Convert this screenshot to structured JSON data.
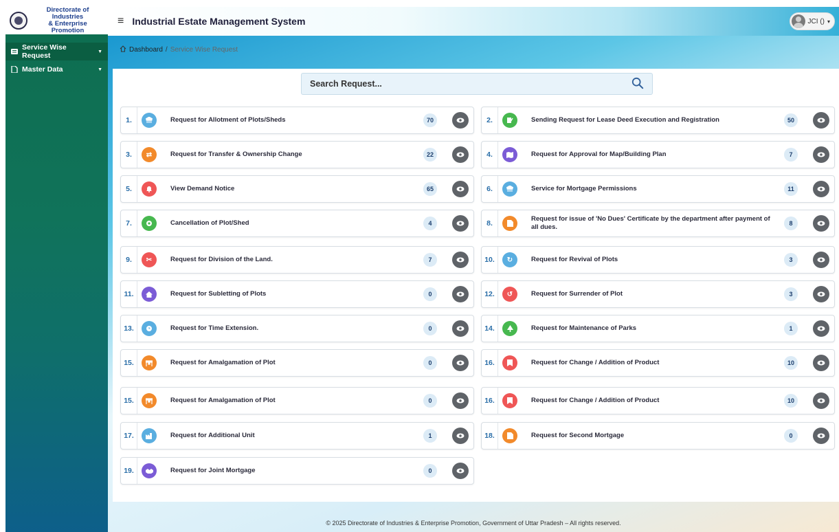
{
  "brand": {
    "line1": "Directorate of Industries",
    "line2": "& Enterprise Promotion"
  },
  "sidebar": {
    "items": [
      {
        "label": "Service Wise Request",
        "icon": "list-icon"
      },
      {
        "label": "Master Data",
        "icon": "document-icon"
      }
    ]
  },
  "header": {
    "title": "Industrial Estate Management System",
    "user": "JCI ()"
  },
  "breadcrumb": {
    "home": "Dashboard",
    "separator": "/",
    "current": "Service Wise Request"
  },
  "search": {
    "placeholder": "Search Request..."
  },
  "requests": [
    {
      "no": "1.",
      "label": "Request for Allotment of Plots/Sheds",
      "count": "70",
      "icon": "bank-icon",
      "color": "#5aaee0"
    },
    {
      "no": "2.",
      "label": "Sending Request for Lease Deed Execution and Registration",
      "count": "50",
      "icon": "edit-doc-icon",
      "color": "#47b84f"
    },
    {
      "no": "3.",
      "label": "Request for Transfer & Ownership Change",
      "count": "22",
      "icon": "transfer-icon",
      "color": "#f28a2b"
    },
    {
      "no": "4.",
      "label": "Request for Approval for Map/Building Plan",
      "count": "7",
      "icon": "map-icon",
      "color": "#7b5cd6"
    },
    {
      "no": "5.",
      "label": "View Demand Notice",
      "count": "65",
      "icon": "bell-icon",
      "color": "#ef5656"
    },
    {
      "no": "6.",
      "label": "Service for Mortgage Permissions",
      "count": "11",
      "icon": "bank-icon",
      "color": "#5aaee0"
    },
    {
      "no": "7.",
      "label": "Cancellation of Plot/Shed",
      "count": "4",
      "icon": "cancel-icon",
      "color": "#47b84f"
    },
    {
      "no": "8.",
      "label": "Request for issue of 'No Dues' Certificate by the department after payment of all dues.",
      "count": "8",
      "icon": "certificate-icon",
      "color": "#f28a2b"
    },
    {
      "no": "9.",
      "label": "Request for Division of the Land.",
      "count": "7",
      "icon": "scissors-icon",
      "color": "#ef5656"
    },
    {
      "no": "10.",
      "label": "Request for Revival of Plots",
      "count": "3",
      "icon": "refresh-icon",
      "color": "#5aaee0"
    },
    {
      "no": "11.",
      "label": "Request for Subletting of Plots",
      "count": "0",
      "icon": "home-icon",
      "color": "#7b5cd6"
    },
    {
      "no": "12.",
      "label": "Request for Surrender of Plot",
      "count": "3",
      "icon": "undo-icon",
      "color": "#ef5656"
    },
    {
      "no": "13.",
      "label": "Request for Time Extension.",
      "count": "0",
      "icon": "clock-icon",
      "color": "#5aaee0"
    },
    {
      "no": "14.",
      "label": "Request for Maintenance of Parks",
      "count": "1",
      "icon": "tree-icon",
      "color": "#47b84f"
    },
    {
      "no": "15.",
      "label": "Request for Amalgamation of Plot",
      "count": "0",
      "icon": "merge-icon",
      "color": "#f28a2b"
    },
    {
      "no": "16.",
      "label": "Request for Change / Addition of Product",
      "count": "10",
      "icon": "bookmark-icon",
      "color": "#ef5656"
    },
    {
      "no": "15.",
      "label": "Request for Amalgamation of Plot",
      "count": "0",
      "icon": "merge-icon",
      "color": "#f28a2b"
    },
    {
      "no": "16.",
      "label": "Request for Change / Addition of Product",
      "count": "10",
      "icon": "bookmark-icon",
      "color": "#ef5656"
    },
    {
      "no": "17.",
      "label": "Request for Additional Unit",
      "count": "1",
      "icon": "factory-icon",
      "color": "#5aaee0"
    },
    {
      "no": "18.",
      "label": "Request for Second Mortgage",
      "count": "0",
      "icon": "document-icon",
      "color": "#f28a2b"
    },
    {
      "no": "19.",
      "label": "Request for Joint Mortgage",
      "count": "0",
      "icon": "handshake-icon",
      "color": "#7b5cd6"
    }
  ],
  "footer": {
    "text": "© 2025 Directorate of Industries & Enterprise Promotion, Government of Uttar Pradesh – All rights reserved."
  }
}
